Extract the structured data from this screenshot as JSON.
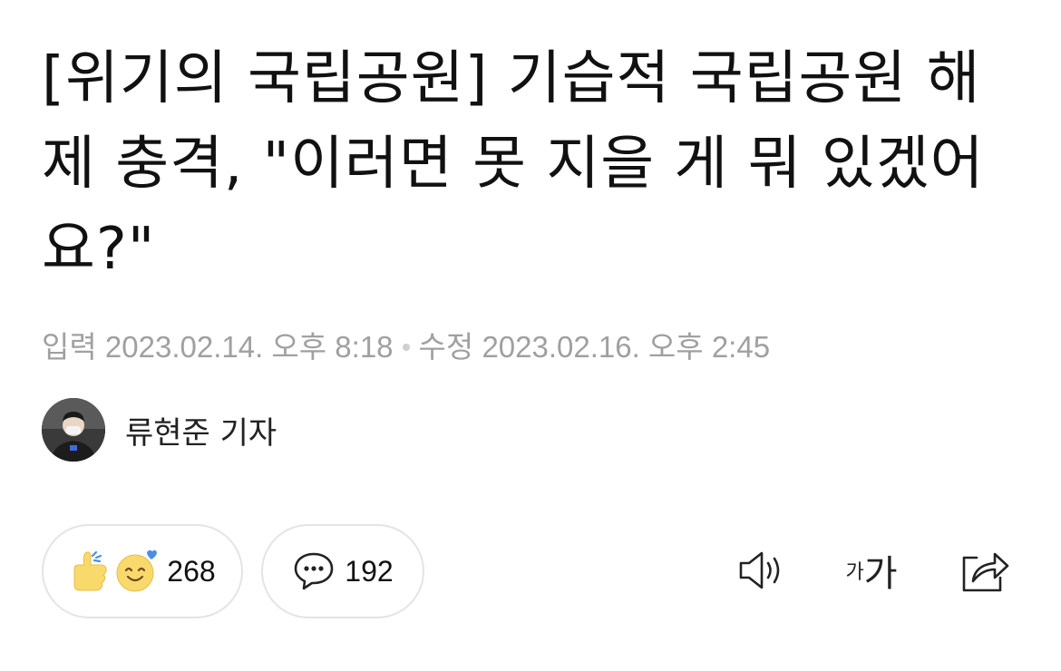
{
  "article": {
    "headline": "[위기의 국립공원] 기습적 국립공원 해제 충격, \"이러면 못 지을 게 뭐 있겠어요?\"",
    "input_label": "입력",
    "input_datetime": "2023.02.14. 오후 8:18",
    "modified_label": "수정",
    "modified_datetime": "2023.02.16. 오후 2:45",
    "author": "류현준 기자"
  },
  "actions": {
    "reaction_count": "268",
    "comment_count": "192",
    "font_size_small": "가",
    "font_size_large": "가"
  },
  "icons": {
    "reaction": [
      "thumbs-up-icon",
      "smile-emoji-icon"
    ],
    "comment": "speech-bubble-icon",
    "speaker": "speaker-icon",
    "share": "share-icon"
  },
  "colors": {
    "text": "#111111",
    "meta": "#a0a0a0",
    "pill_border": "#e4e4e4",
    "emoji_yellow": "#f9d96b",
    "emoji_blue": "#4a8ee8"
  }
}
